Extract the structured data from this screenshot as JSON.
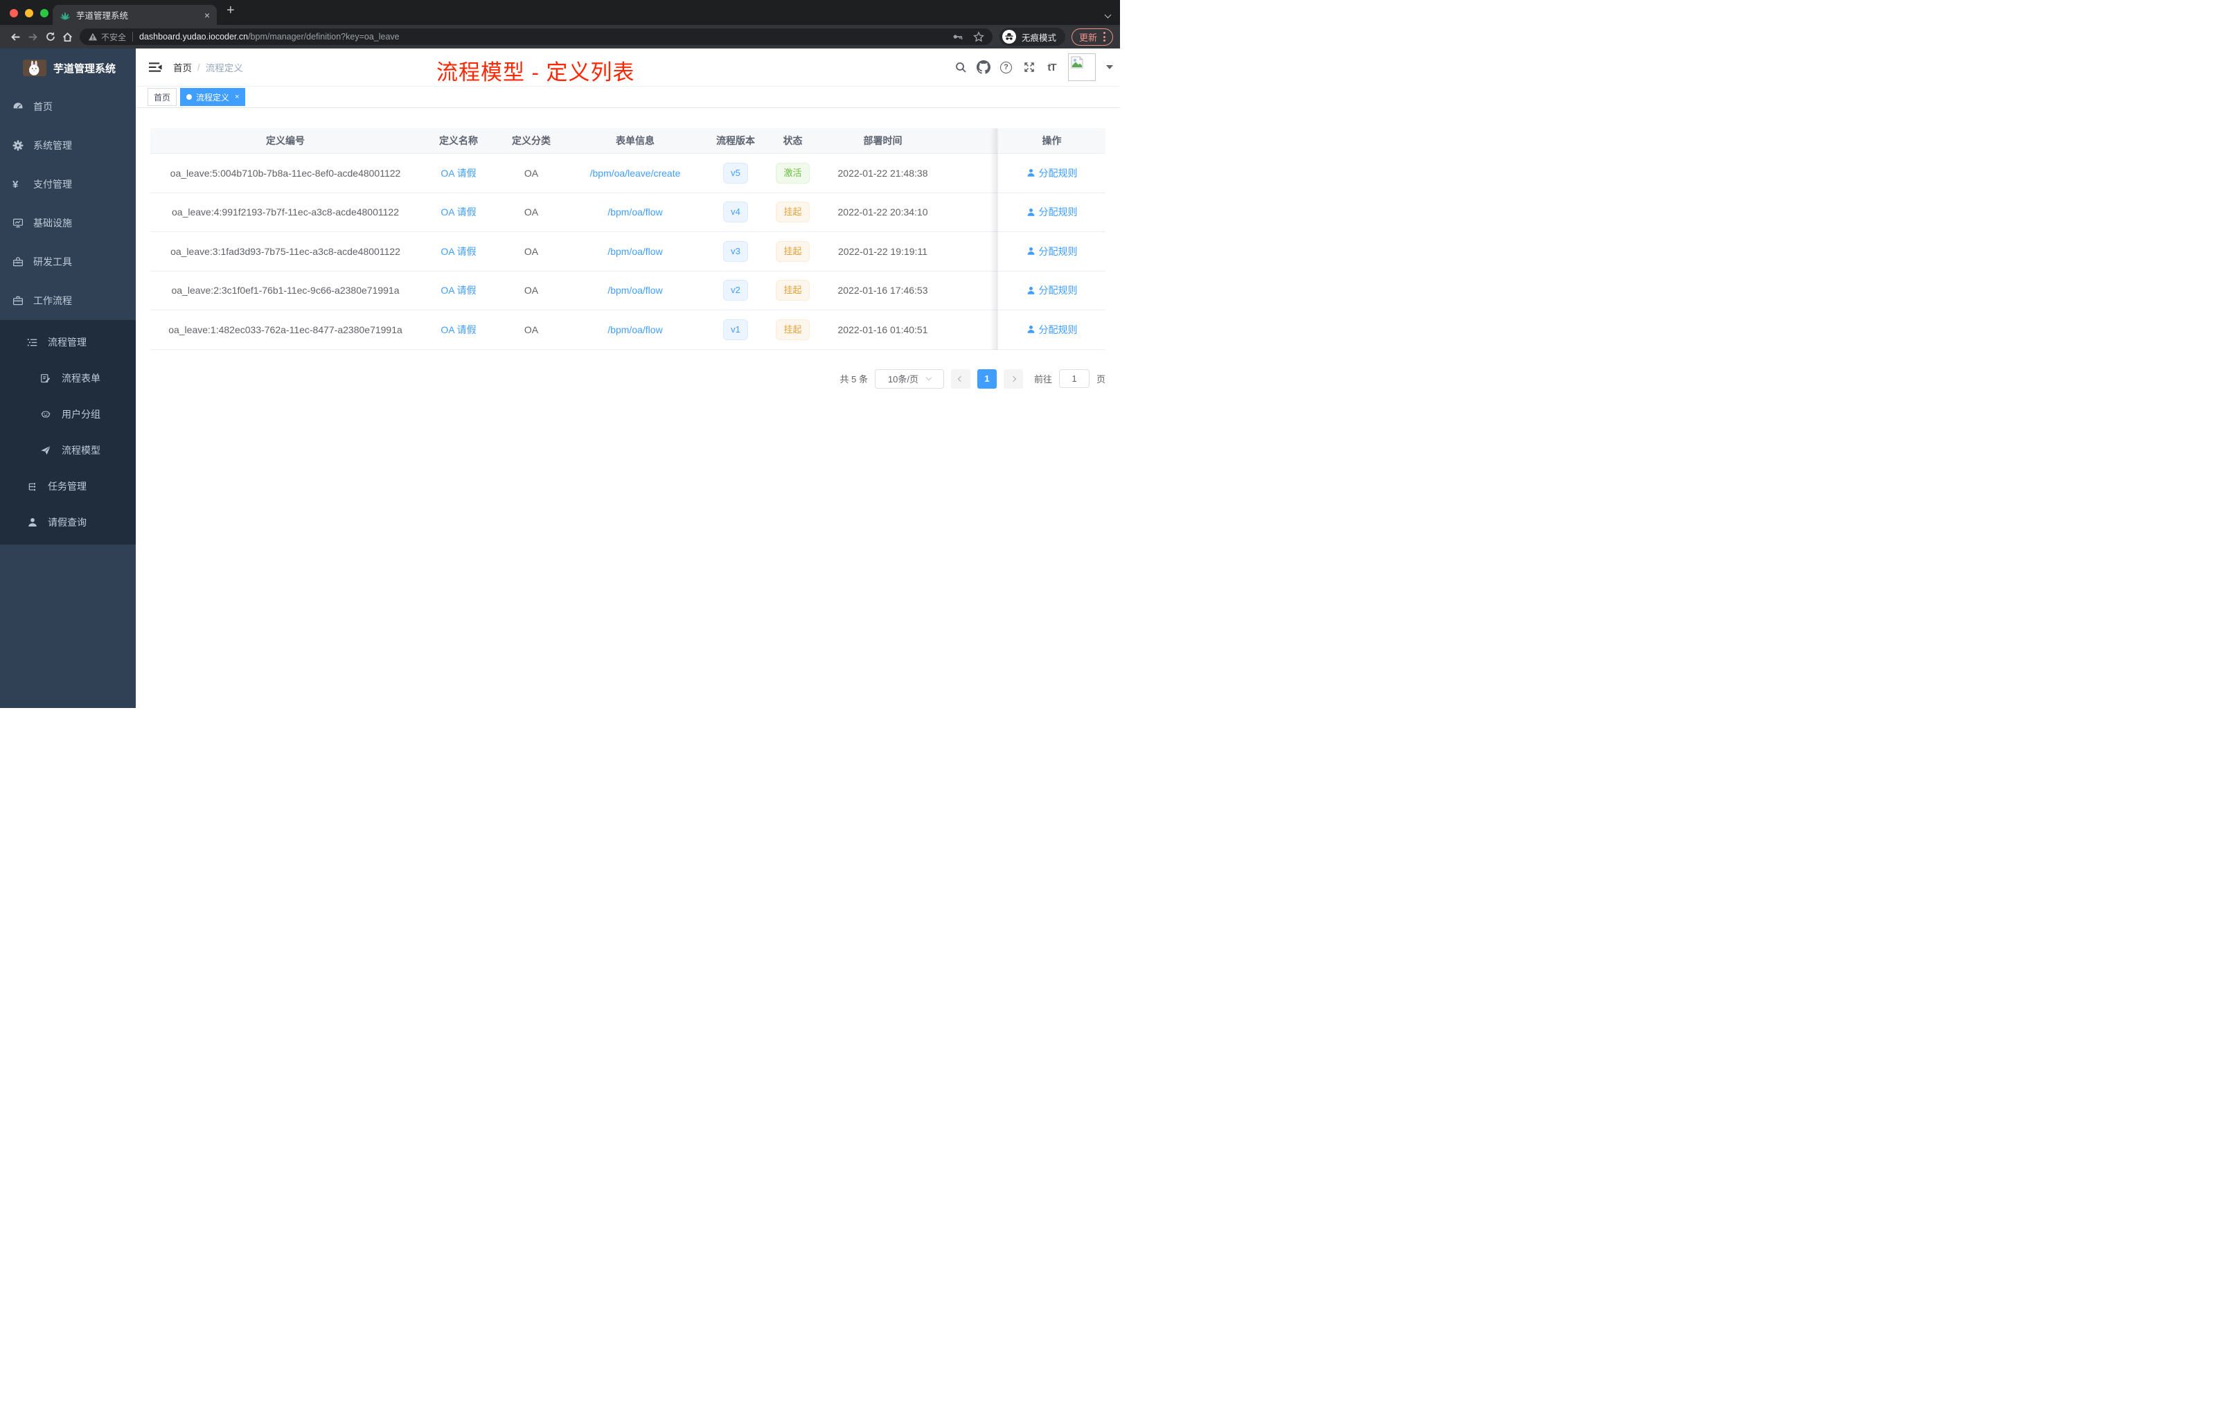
{
  "colors": {
    "accent": "#409eff",
    "success": "#67c23a",
    "warning": "#e6a23c",
    "annotation_red": "#ff2600",
    "sidebar_bg": "#304156",
    "submenu_bg": "#1f2d3d"
  },
  "browser": {
    "tab_title": "芋道管理系统",
    "tab_close_glyph": "×",
    "new_tab_glyph": "+",
    "security_label": "不安全",
    "url_host": "dashboard.yudao.iocoder.cn",
    "url_path": "/bpm/manager/definition?key=oa_leave",
    "incognito_label": "无痕模式",
    "update_label": "更新"
  },
  "sidebar": {
    "logo_title": "芋道管理系统",
    "yen_glyph": "¥",
    "items": [
      {
        "label": "首页"
      },
      {
        "label": "系统管理"
      },
      {
        "label": "支付管理"
      },
      {
        "label": "基础设施"
      },
      {
        "label": "研发工具"
      },
      {
        "label": "工作流程"
      },
      {
        "label": "流程管理"
      },
      {
        "label": "流程表单"
      },
      {
        "label": "用户分组"
      },
      {
        "label": "流程模型"
      },
      {
        "label": "任务管理"
      },
      {
        "label": "请假查询"
      }
    ]
  },
  "header": {
    "breadcrumb_home": "首页",
    "breadcrumb_separator": "/",
    "breadcrumb_current": "流程定义",
    "annotation": "流程模型 - 定义列表",
    "help_glyph": "?",
    "font_size_glyph": "tT"
  },
  "tags": {
    "home": "首页",
    "active": "流程定义",
    "close_glyph": "×"
  },
  "table": {
    "headers": [
      "定义编号",
      "定义名称",
      "定义分类",
      "表单信息",
      "流程版本",
      "状态",
      "部署时间",
      "操作"
    ],
    "action_label": "分配规则",
    "rows": [
      {
        "id": "oa_leave:5:004b710b-7b8a-11ec-8ef0-acde48001122",
        "name": "OA 请假",
        "category": "OA",
        "form": "/bpm/oa/leave/create",
        "version": "v5",
        "status": "激活",
        "time": "2022-01-22 21:48:38"
      },
      {
        "id": "oa_leave:4:991f2193-7b7f-11ec-a3c8-acde48001122",
        "name": "OA 请假",
        "category": "OA",
        "form": "/bpm/oa/flow",
        "version": "v4",
        "status": "挂起",
        "time": "2022-01-22 20:34:10"
      },
      {
        "id": "oa_leave:3:1fad3d93-7b75-11ec-a3c8-acde48001122",
        "name": "OA 请假",
        "category": "OA",
        "form": "/bpm/oa/flow",
        "version": "v3",
        "status": "挂起",
        "time": "2022-01-22 19:19:11"
      },
      {
        "id": "oa_leave:2:3c1f0ef1-76b1-11ec-9c66-a2380e71991a",
        "name": "OA 请假",
        "category": "OA",
        "form": "/bpm/oa/flow",
        "version": "v2",
        "status": "挂起",
        "time": "2022-01-16 17:46:53"
      },
      {
        "id": "oa_leave:1:482ec033-762a-11ec-8477-a2380e71991a",
        "name": "OA 请假",
        "category": "OA",
        "form": "/bpm/oa/flow",
        "version": "v1",
        "status": "挂起",
        "time": "2022-01-16 01:40:51"
      }
    ]
  },
  "pagination": {
    "total": "共 5 条",
    "page_size": "10条/页",
    "current_page": "1",
    "goto_label": "前往",
    "goto_value": "1",
    "unit_label": "页"
  }
}
